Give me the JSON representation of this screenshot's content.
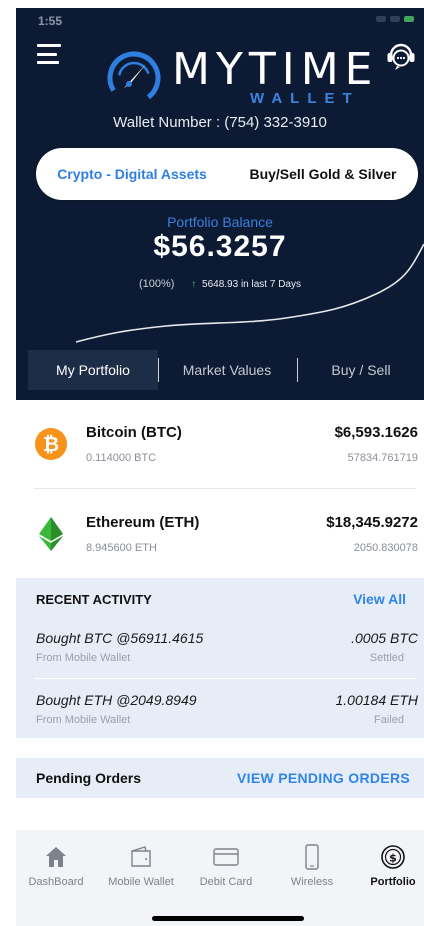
{
  "status_bar": {
    "time": "1:55"
  },
  "brand": {
    "title": "MYTIME",
    "subtitle": "WALLET"
  },
  "wallet": {
    "number_text": "Wallet Number : (754) 332-3910"
  },
  "segments": [
    {
      "label": "Crypto - Digital Assets",
      "selected": true
    },
    {
      "label": "Buy/Sell Gold & Silver",
      "selected": false
    }
  ],
  "portfolio": {
    "label": "Portfolio Balance",
    "value": "$56.3257",
    "percent": "(100%)",
    "change": "5648.93 in last 7 Days"
  },
  "tabs": [
    {
      "label": "My Portfolio",
      "selected": true
    },
    {
      "label": "Market Values",
      "selected": false
    },
    {
      "label": "Buy / Sell",
      "selected": false
    }
  ],
  "holdings": [
    {
      "name": "Bitcoin (BTC)",
      "quantity": "0.114000 BTC",
      "value": "$6,593.1626",
      "price": "57834.761719",
      "icon": "bitcoin-icon"
    },
    {
      "name": "Ethereum (ETH)",
      "quantity": "8.945600 ETH",
      "value": "$18,345.9272",
      "price": "2050.830078",
      "icon": "ethereum-icon"
    }
  ],
  "activity": {
    "title": "RECENT ACTIVITY",
    "view_all": "View All",
    "items": [
      {
        "description": "Bought BTC @56911.4615",
        "source": "From Mobile Wallet",
        "amount": ".0005 BTC",
        "status": "Settled"
      },
      {
        "description": "Bought ETH @2049.8949",
        "source": "From Mobile Wallet",
        "amount": "1.00184 ETH",
        "status": "Failed"
      }
    ]
  },
  "pending": {
    "title": "Pending Orders",
    "link": "VIEW PENDING ORDERS"
  },
  "bottom_nav": [
    {
      "label": "DashBoard",
      "icon": "home-icon",
      "active": false
    },
    {
      "label": "Mobile Wallet",
      "icon": "wallet-icon",
      "active": false
    },
    {
      "label": "Debit Card",
      "icon": "card-icon",
      "active": false
    },
    {
      "label": "Wireless",
      "icon": "phone-icon",
      "active": false
    },
    {
      "label": "Portfolio",
      "icon": "dollar-circle-icon",
      "active": true
    }
  ],
  "colors": {
    "header_bg": "#0c1b33",
    "accent_blue": "#2f85e8",
    "positive_green": "#3ec26b",
    "activity_bg": "#e7edf7",
    "bitcoin_orange": "#f7931a",
    "ethereum_green": "#3ab83a"
  }
}
